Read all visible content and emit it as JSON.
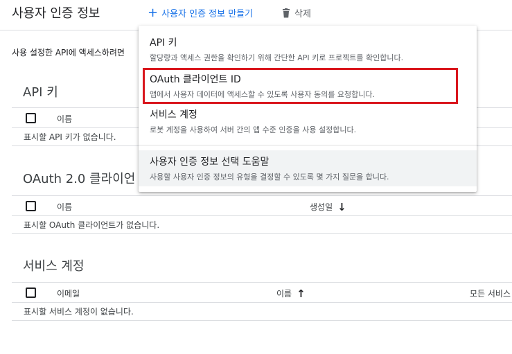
{
  "header": {
    "title": "사용자 인증 정보",
    "create_label": "사용자 인증 정보 만들기",
    "delete_label": "삭제"
  },
  "intro_text": "사용 설정한 API에 액세스하려면",
  "api_keys": {
    "title": "API 키",
    "columns": [
      "이름"
    ],
    "empty": "표시할 API 키가 없습니다."
  },
  "oauth": {
    "title": "OAuth 2.0 클라이언",
    "columns": [
      "이름",
      "생성일"
    ],
    "sort_icon": "arrow-down-icon",
    "empty": "표시할 OAuth 클라이언트가 없습니다."
  },
  "service_accounts": {
    "title": "서비스 계정",
    "columns": [
      "이메일",
      "이름",
      "모든 서비스"
    ],
    "sort_icon": "arrow-up-icon",
    "empty": "표시할 서비스 계정이 없습니다."
  },
  "menu": {
    "items": [
      {
        "title": "API 키",
        "desc": "할당량과 액세스 권한을 확인하기 위해 간단한 API 키로 프로젝트를 확인합니다."
      },
      {
        "title": "OAuth 클라이언트 ID",
        "desc": "앱에서 사용자 데이터에 액세스할 수 있도록 사용자 동의를 요청합니다.",
        "highlighted": true
      },
      {
        "title": "서비스 계정",
        "desc": "로봇 계정을 사용하여 서버 간의 앱 수준 인증을 사용 설정합니다."
      }
    ],
    "help": {
      "title": "사용자 인증 정보 선택 도움말",
      "desc": "사용할 사용자 인증 정보의 유형을 결정할 수 있도록 몇 가지 질문을 합니다."
    }
  },
  "colors": {
    "accent": "#1a73e8",
    "highlight_border": "#d9161d",
    "divider": "#dadce0"
  }
}
